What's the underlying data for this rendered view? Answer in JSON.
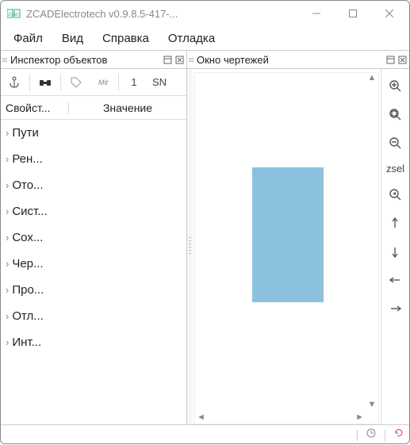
{
  "window": {
    "title": "ZCADElectrotech v0.9.8.5-417-..."
  },
  "menu": {
    "items": [
      "Файл",
      "Вид",
      "Справка",
      "Отладка"
    ]
  },
  "panels": {
    "inspector_title": "Инспектор объектов",
    "drawing_title": "Окно чертежей"
  },
  "inspector": {
    "toolbar": {
      "page": "1",
      "sn": "SN"
    },
    "columns": {
      "prop": "Свойст...",
      "value": "Значение"
    },
    "rows": [
      "Пути",
      "Рен...",
      "Ото...",
      "Сист...",
      "Сох...",
      "Чер...",
      "Про...",
      "Отл...",
      "Инт..."
    ]
  },
  "rightbar": {
    "zsel": "zsel"
  },
  "canvas": {
    "shape_color": "#8cc1de"
  }
}
